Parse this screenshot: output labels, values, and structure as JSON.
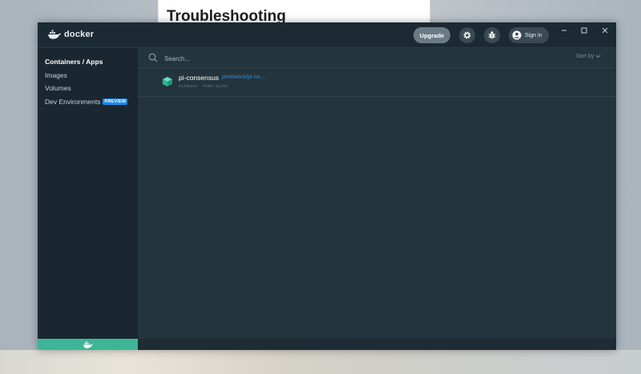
{
  "background": {
    "doc_heading": "Troubleshooting"
  },
  "titlebar": {
    "logo_text": "docker",
    "upgrade_label": "Upgrade",
    "signin_label": "Sign in",
    "settings_icon": "gear-icon",
    "troubleshoot_icon": "bug-icon"
  },
  "sidebar": {
    "items": [
      {
        "label": "Containers / Apps",
        "active": true
      },
      {
        "label": "Images"
      },
      {
        "label": "Volumes"
      },
      {
        "label": "Dev Environments",
        "badge": "PREVIEW"
      }
    ]
  },
  "main": {
    "search": {
      "placeholder": "Search..."
    },
    "sort_label": "Sort by",
    "containers": [
      {
        "name": "pi-consensus",
        "image": "pinetwork/pi-no...",
        "status": "RUNNING",
        "port": "PORT: 31400"
      }
    ]
  },
  "colors": {
    "accent_green": "#3fb598",
    "link_blue": "#2b8ae0",
    "badge_blue": "#1d8be6"
  }
}
